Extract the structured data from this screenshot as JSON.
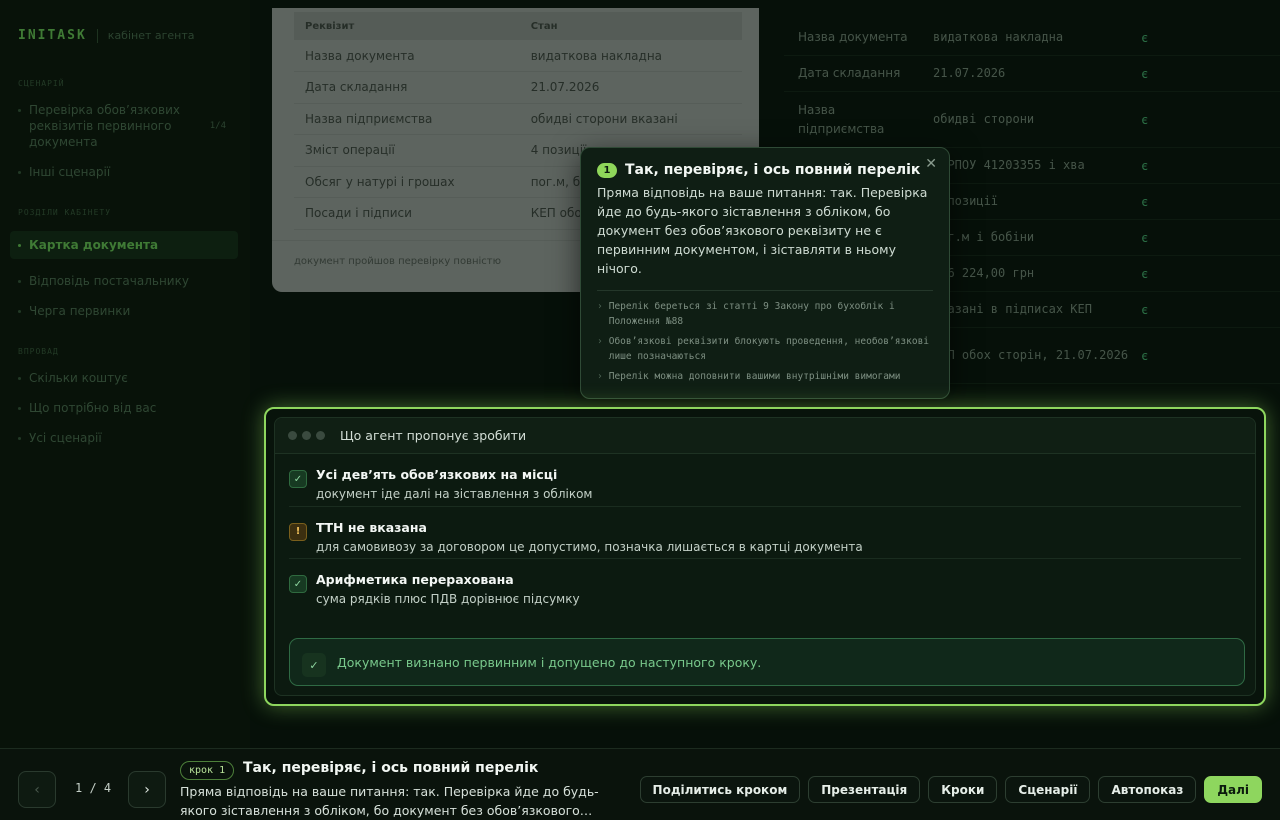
{
  "brand": {
    "name": "INITASK",
    "subtitle": "кабінет агента"
  },
  "sidebar": {
    "sections": [
      {
        "title": "Сценарій",
        "items": [
          {
            "label": "Перевірка обов’язкових реквізитів первинного документа",
            "badge": "1/4"
          },
          {
            "label": "Інші сценарії"
          }
        ]
      },
      {
        "title": "Розділи кабінету",
        "items": [
          {
            "label": "Картка документа",
            "active": true
          },
          {
            "label": "Відповідь постачальнику"
          },
          {
            "label": "Черга первинки"
          }
        ]
      },
      {
        "title": "Впровад",
        "items": [
          {
            "label": "Скільки коштує"
          },
          {
            "label": "Що потрібно від вас"
          },
          {
            "label": "Усі сценарії"
          }
        ]
      }
    ]
  },
  "doc_card": {
    "headers": [
      "Реквізит",
      "Стан"
    ],
    "rows": [
      [
        "Назва документа",
        "видаткова накладна"
      ],
      [
        "Дата складання",
        "21.07.2026"
      ],
      [
        "Назва підприємства",
        "обидві сторони вказані"
      ],
      [
        "Зміст операції",
        "4 позиції з од"
      ],
      [
        "Обсяг у натурі і грошах",
        "пог.м, бобіни"
      ],
      [
        "Посади і підписи",
        "КЕП обох ст"
      ]
    ],
    "note": "документ пройшов перевірку повністю"
  },
  "right_table": {
    "rows": [
      [
        "Назва документа",
        "видаткова накладна",
        "є"
      ],
      [
        "Дата складання",
        "21.07.2026",
        "є"
      ],
      [
        "Назва підприємства",
        "обидві сторони",
        "є"
      ],
      [
        "",
        "ЄДРПОУ 41203355 і хва",
        "є"
      ],
      [
        "",
        "4 позиції",
        "є"
      ],
      [
        "",
        "пог.м і бобіни",
        "є"
      ],
      [
        "",
        "216 224,00 грн",
        "є"
      ],
      [
        "",
        "вказані в підписах КЕП",
        "є"
      ],
      [
        "",
        "КЕП обох сторін, 21.07.2026",
        "є"
      ]
    ]
  },
  "popover": {
    "number": "1",
    "title": "Так, перевіряє, і ось повний перелік",
    "text": "Пряма відповідь на ваше питання: так. Перевірка йде до будь-якого зіставлення з обліком, бо документ без обов’язкового реквізиту не є первинним документом, і зіставляти в ньому нічого.",
    "points": [
      "Перелік береться зі статті 9 Закону про бухоблік і Положення №88",
      "Обов’язкові реквізити блокують проведення, необов’язкові лише позначаються",
      "Перелік можна доповнити вашими внутрішніми вимогами"
    ],
    "close": "✕"
  },
  "panel": {
    "title": "Що агент пропонує зробити",
    "checks": [
      {
        "status": "ok",
        "icon": "✓",
        "title": "Усі дев’ять обов’язкових на місці",
        "sub": "документ іде далі на зіставлення з обліком"
      },
      {
        "status": "warn",
        "icon": "!",
        "title": "ТТН не вказана",
        "sub": "для самовивозу за договором це допустимо, позначка лишається в картці документа"
      },
      {
        "status": "ok",
        "icon": "✓",
        "title": "Арифметика перерахована",
        "sub": "сума рядків плюс ПДВ дорівнює підсумку"
      }
    ],
    "verdict": {
      "icon": "✓",
      "text": "Документ визнано первинним і допущено до наступного кроку."
    }
  },
  "bottom": {
    "prev": "‹",
    "next": "›",
    "counter": "1 / 4",
    "step_badge": "крок 1",
    "step_title": "Так, перевіряє, і ось повний перелік",
    "step_text": "Пряма відповідь на ваше питання: так. Перевірка йде до будь-якого зіставлення з обліком, бо документ без обов’язкового…",
    "actions": [
      "Поділитись кроком",
      "Презентація",
      "Кроки",
      "Сценарії",
      "Автопоказ",
      "Далі"
    ]
  },
  "colors": {
    "accent": "#8ed65e",
    "ok": "#8ed6a0",
    "warn": "#f0c05a",
    "background": "#061009"
  }
}
